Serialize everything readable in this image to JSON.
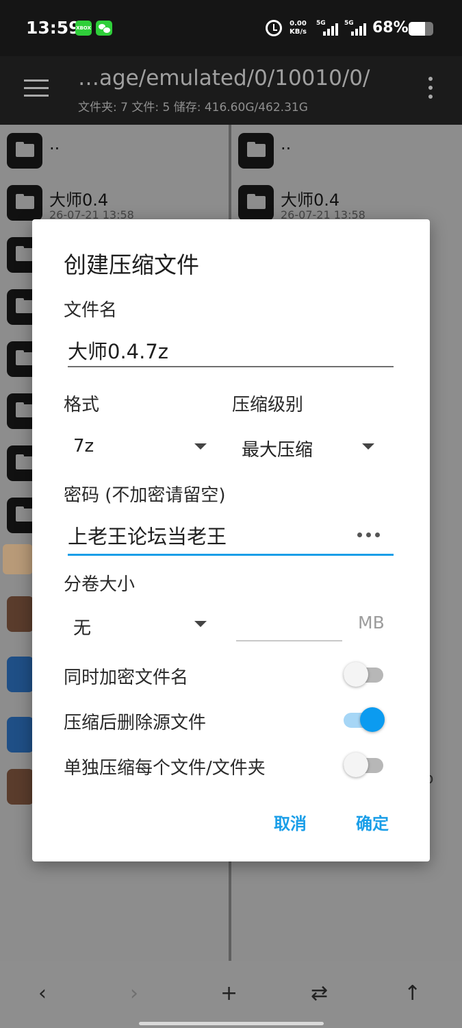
{
  "status_bar": {
    "time": "13:59",
    "xbox_badge": "XBOX",
    "net_speed_value": "0.00",
    "net_speed_unit": "KB/s",
    "signal1_label": "5G",
    "signal2_label": "5G",
    "battery_percent": "68%",
    "battery_level": 0.68
  },
  "toolbar": {
    "path": "…age/emulated/0/10010/0/",
    "summary": "文件夹: 7  文件: 5  储存: 416.60G/462.31G"
  },
  "left_pane": {
    "rows": [
      {
        "name": ".."
      },
      {
        "name": "大师0.4",
        "date": "26-07-21 13:58"
      }
    ]
  },
  "right_pane": {
    "rows": [
      {
        "name": ".."
      },
      {
        "name": "大师0.4",
        "date": "26-07-21 13:58"
      }
    ],
    "partial_text": "o"
  },
  "dialog": {
    "title": "创建压缩文件",
    "filename_label": "文件名",
    "filename_value": "大师0.4.7z",
    "format_label": "格式",
    "format_value": "7z",
    "level_label": "压缩级别",
    "level_value": "最大压缩",
    "password_label": "密码 (不加密请留空)",
    "password_value": "上老王论坛当老王",
    "volume_label": "分卷大小",
    "volume_value": "无",
    "volume_size_value": "",
    "volume_unit": "MB",
    "toggles": [
      {
        "label": "同时加密文件名",
        "on": false
      },
      {
        "label": "压缩后删除源文件",
        "on": true
      },
      {
        "label": "单独压缩每个文件/文件夹",
        "on": false
      }
    ],
    "cancel_label": "取消",
    "ok_label": "确定"
  },
  "bottom_nav": {
    "back": "‹",
    "forward": "›",
    "add": "+",
    "swap": "⇄",
    "up": "↑"
  },
  "colors": {
    "accent": "#1a9ee8",
    "switch_on": "#0b9bf0",
    "switch_on_track": "#a6d6f6",
    "toolbar_bg": "#1b1b1b"
  }
}
